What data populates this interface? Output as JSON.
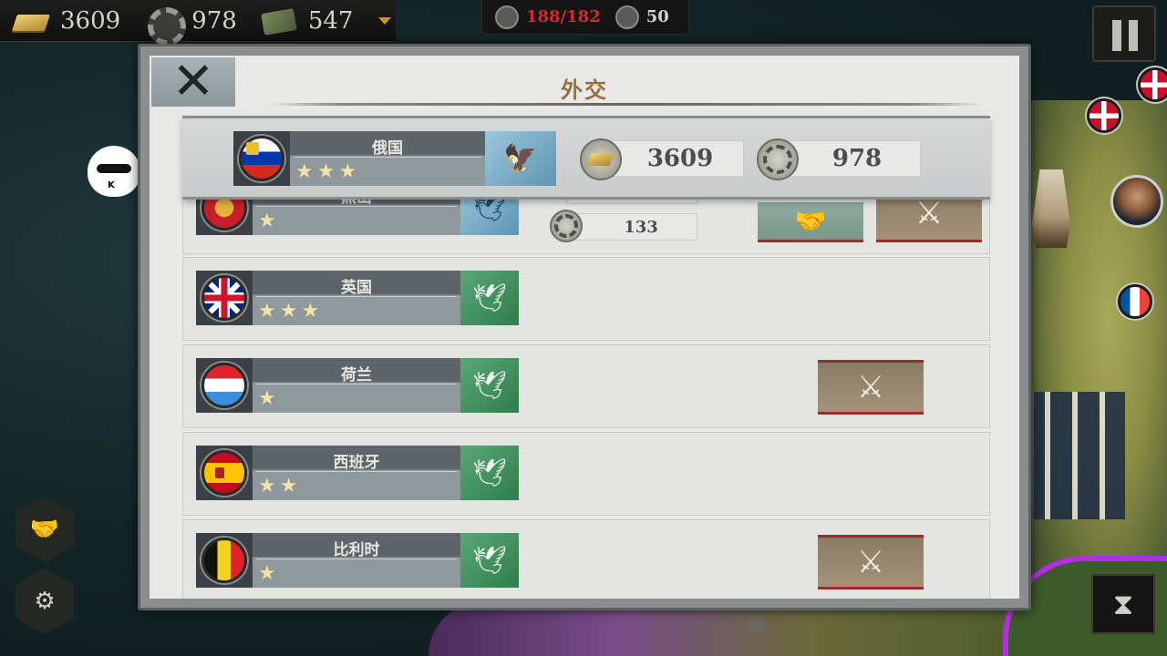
{
  "hud": {
    "gold": "3609",
    "industry": "978",
    "supply": "547",
    "population": "188/182",
    "turn": "50"
  },
  "dialog": {
    "title": "外交",
    "close_label": "✕"
  },
  "player": {
    "name": "俄国",
    "stars": 3,
    "gold": "3609",
    "industry": "978",
    "emblem": "eagle-icon"
  },
  "nations": [
    {
      "name": "黑山",
      "stars": 1,
      "emblem": "eagle-icon",
      "flag": "montenegro",
      "industry_cost": "133",
      "actions": [
        "alliance",
        "war"
      ]
    },
    {
      "name": "英国",
      "stars": 3,
      "emblem": "peace-dove-icon",
      "flag": "uk",
      "actions": []
    },
    {
      "name": "荷兰",
      "stars": 1,
      "emblem": "peace-dove-icon",
      "flag": "netherlands",
      "actions": [
        "war"
      ]
    },
    {
      "name": "西班牙",
      "stars": 2,
      "emblem": "peace-dove-icon",
      "flag": "spain",
      "actions": []
    },
    {
      "name": "比利时",
      "stars": 1,
      "emblem": "peace-dove-icon",
      "flag": "belgium",
      "actions": [
        "war"
      ]
    }
  ],
  "colors": {
    "title": "#9a6e44",
    "war_border": "#9b2a2a",
    "peace_emblem": "#2f7c4e",
    "hostile_emblem": "#5e95b3",
    "population_over": "#d8282a"
  }
}
